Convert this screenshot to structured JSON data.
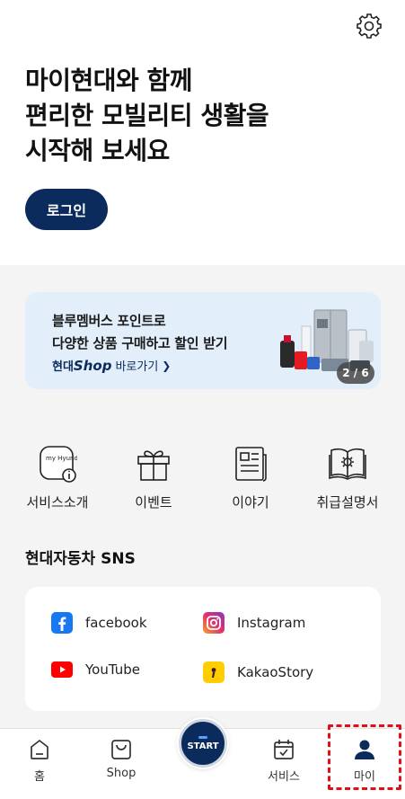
{
  "header": {
    "settings_icon": "gear-icon"
  },
  "hero": {
    "lines": [
      "마이현대와 함께",
      "편리한 모빌리티 생활을",
      "시작해 보세요"
    ],
    "login_label": "로그인"
  },
  "banner": {
    "line1": "블루멤버스 포인트로",
    "line2": "다양한 상품 구매하고 할인 받기",
    "shop_prefix": "현대",
    "shop_brand": "Shop",
    "shop_link": "바로가기",
    "page_indicator": "2 / 6"
  },
  "menu": {
    "items": [
      {
        "label": "서비스소개",
        "icon": "myhyundai-info-icon",
        "icon_text": "my Hyundai"
      },
      {
        "label": "이벤트",
        "icon": "gift-icon"
      },
      {
        "label": "이야기",
        "icon": "document-icon"
      },
      {
        "label": "취급설명서",
        "icon": "manual-book-icon"
      }
    ]
  },
  "sns": {
    "title": "현대자동차 SNS",
    "items": [
      {
        "label": "facebook",
        "icon": "facebook-icon",
        "color": "#1877f2"
      },
      {
        "label": "Instagram",
        "icon": "instagram-icon",
        "color": "#e1306c"
      },
      {
        "label": "YouTube",
        "icon": "youtube-icon",
        "color": "#ff0000"
      },
      {
        "label": "KakaoStory",
        "icon": "kakaostory-icon",
        "color": "#ffcd00"
      }
    ]
  },
  "nav": {
    "items": [
      {
        "label": "홈",
        "icon": "home-icon"
      },
      {
        "label": "Shop",
        "icon": "shopping-bag-icon"
      },
      {
        "label": "서비스",
        "icon": "calendar-check-icon"
      },
      {
        "label": "마이",
        "icon": "person-icon"
      }
    ],
    "start_label": "START"
  },
  "colors": {
    "brand_navy": "#0b2b5c",
    "banner_bg": "#e2eef9",
    "highlight": "#e0101a"
  }
}
